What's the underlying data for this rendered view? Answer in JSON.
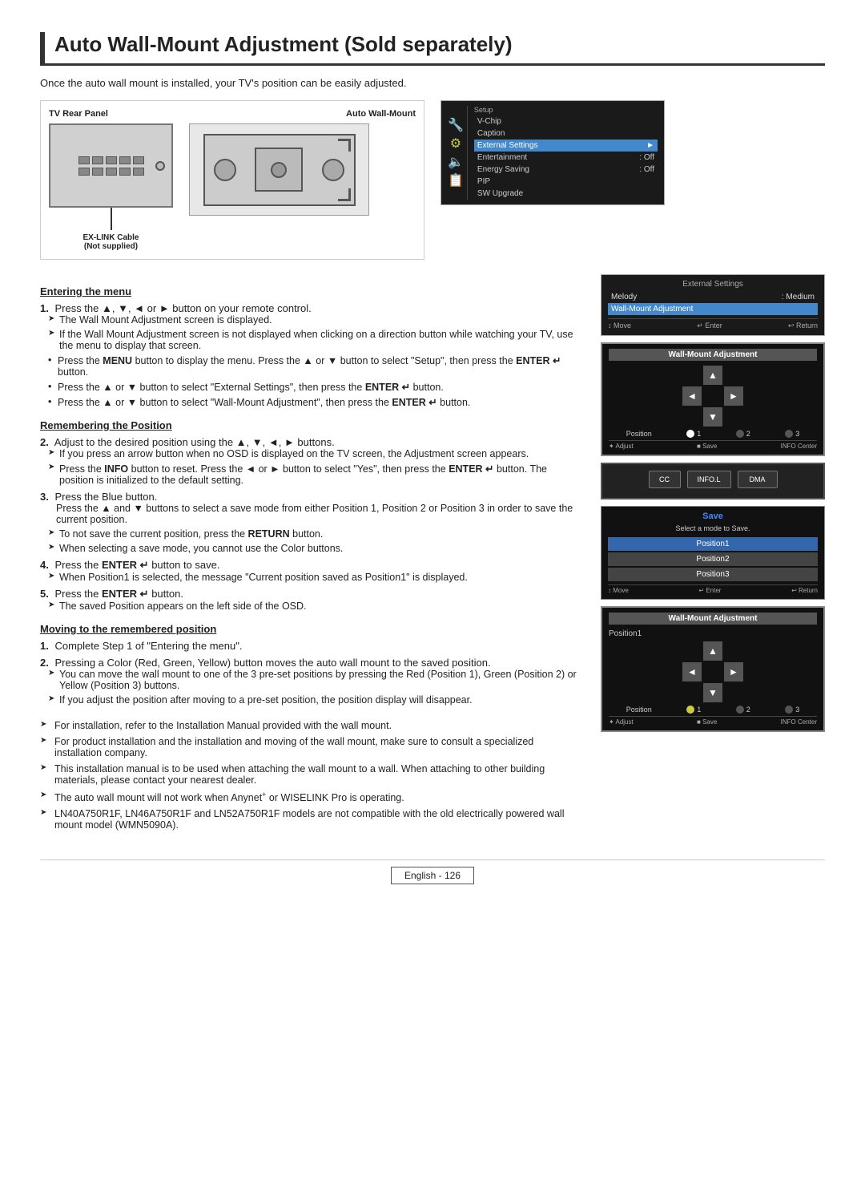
{
  "page": {
    "title": "Auto Wall-Mount Adjustment (Sold separately)",
    "intro": "Once the auto wall mount is installed, your TV's position can be easily adjusted.",
    "footer": "English - 126"
  },
  "diagram": {
    "label_left": "TV Rear Panel",
    "label_right": "Auto Wall-Mount",
    "cable_label": "EX-LINK Cable\n(Not supplied)"
  },
  "setup_menu": {
    "title": "External Settings",
    "items": [
      {
        "label": "V-Chip",
        "value": ""
      },
      {
        "label": "Caption",
        "value": ""
      },
      {
        "label": "External Settings",
        "value": "",
        "selected": true
      },
      {
        "label": "Entertainment",
        "value": "Off"
      },
      {
        "label": "Energy Saving",
        "value": "Off"
      },
      {
        "label": "PIP",
        "value": ""
      },
      {
        "label": "SW Upgrade",
        "value": ""
      }
    ]
  },
  "external_settings_menu": {
    "title": "External Settings",
    "items": [
      {
        "label": "Melody",
        "value": "Medium"
      },
      {
        "label": "Wall-Mount Adjustment",
        "value": ""
      }
    ],
    "footer": [
      "↕ Move",
      "↵ Enter",
      "↩ Return"
    ]
  },
  "wall_mount_adjustment_screen1": {
    "title": "Wall-Mount Adjustment",
    "position_labels": [
      "Position",
      "1",
      "2",
      "3"
    ],
    "footer": [
      "✦ Adjust",
      "■ Save",
      "INFO Center"
    ]
  },
  "save_screen": {
    "title": "Save",
    "subtitle": "Select a mode to Save.",
    "options": [
      "Position1",
      "Position2",
      "Position3"
    ],
    "footer": [
      "↕ Move",
      "↵ Enter",
      "↩ Return"
    ]
  },
  "wall_mount_adjustment_screen2": {
    "title": "Wall-Mount Adjustment",
    "label": "Position1",
    "position_labels": [
      "Position",
      "1",
      "2",
      "3"
    ],
    "footer": [
      "✦ Adjust",
      "■ Save",
      "INFO Center"
    ]
  },
  "sections": {
    "entering_menu": {
      "heading": "Entering the menu",
      "steps": [
        {
          "number": "1.",
          "text": "Press the ▲, ▼, ◄ or ► button on your remote control.",
          "sub": [
            {
              "type": "arrow",
              "text": "The Wall Mount Adjustment screen is displayed."
            },
            {
              "type": "arrow",
              "text": "If the Wall Mount Adjustment screen is not displayed when clicking on a direction button while watching your TV, use the menu to display that screen."
            },
            {
              "type": "bullet",
              "text": "Press the MENU button to display the menu. Press the ▲ or ▼ button to select \"Setup\", then press the ENTER ↵ button."
            },
            {
              "type": "bullet",
              "text": "Press the ▲ or ▼ button to select \"External Settings\", then press the ENTER ↵ button."
            },
            {
              "type": "bullet",
              "text": "Press the ▲ or ▼ button to select \"Wall-Mount Adjustment\", then press the ENTER ↵ button."
            }
          ]
        }
      ]
    },
    "remembering_position": {
      "heading": "Remembering the Position",
      "steps": [
        {
          "number": "2.",
          "text": "Adjust to the desired position using the ▲, ▼, ◄, ► buttons.",
          "sub": [
            {
              "type": "arrow",
              "text": "If you press an arrow button when no OSD is displayed on the TV screen, the Adjustment screen appears."
            },
            {
              "type": "arrow",
              "text": "Press the INFO button to reset. Press the ◄ or ► button to select \"Yes\", then press the ENTER ↵ button. The position is initialized to the default setting."
            }
          ]
        },
        {
          "number": "3.",
          "text": "Press the Blue button.",
          "sub": [
            {
              "type": "plain",
              "text": "Press the ▲ and ▼ buttons to select a save mode from either Position 1, Position 2 or Position 3 in order to save the current position."
            },
            {
              "type": "arrow",
              "text": "To not save the current position, press the RETURN button."
            },
            {
              "type": "arrow",
              "text": "When selecting a save mode, you cannot use the Color buttons."
            }
          ]
        },
        {
          "number": "4.",
          "text": "Press the ENTER ↵ button to save.",
          "sub": [
            {
              "type": "arrow",
              "text": "When Position1 is selected, the message \"Current position saved as Position1\" is displayed."
            }
          ]
        },
        {
          "number": "5.",
          "text": "Press the ENTER ↵ button.",
          "sub": [
            {
              "type": "arrow",
              "text": "The saved Position appears on the left side of the OSD."
            }
          ]
        }
      ]
    },
    "moving_to_position": {
      "heading": "Moving to the remembered position",
      "steps": [
        {
          "number": "1.",
          "text": "Complete Step 1 of \"Entering the menu\"."
        },
        {
          "number": "2.",
          "text": "Pressing a Color (Red, Green, Yellow) button moves the auto wall mount to the saved position.",
          "sub": [
            {
              "type": "arrow",
              "text": "You can move the wall mount to one of the 3 pre-set positions by pressing the Red (Position 1), Green (Position 2) or Yellow (Position 3) buttons."
            },
            {
              "type": "arrow",
              "text": "If you adjust the position after moving to a pre-set position, the position display will disappear."
            }
          ]
        }
      ]
    }
  },
  "notes": [
    "For installation, refer to the Installation Manual provided with the wall mount.",
    "For product installation and the installation and moving of the wall mount, make sure to consult a specialized installation company.",
    "This installation manual is to be used when attaching the wall mount to a wall. When attaching to other building materials, please contact your nearest dealer.",
    "The auto wall mount will not work when Anynet+ or WISELINK Pro is operating.",
    "LN40A750R1F, LN46A750R1F and LN52A750R1F models are not compatible with the old electrically powered wall mount model (WMN5090A)."
  ]
}
